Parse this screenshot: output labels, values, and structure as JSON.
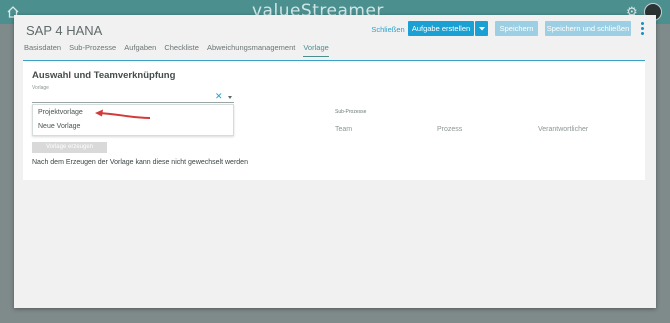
{
  "app": {
    "logo_text": "valueStreamer",
    "icons": [
      "home-icon",
      "settings-icon",
      "avatar"
    ]
  },
  "modal": {
    "title": "SAP 4 HANA",
    "buttons": {
      "close": "Schließen",
      "create_task": "Aufgabe erstellen",
      "save": "Speichern",
      "save_close": "Speichern und schließen"
    },
    "tabs": [
      {
        "label": "Basisdaten",
        "active": false
      },
      {
        "label": "Sub-Prozesse",
        "active": false
      },
      {
        "label": "Aufgaben",
        "active": false
      },
      {
        "label": "Checkliste",
        "active": false
      },
      {
        "label": "Abweichungsmanagement",
        "active": false
      },
      {
        "label": "Vorlage",
        "active": true
      }
    ]
  },
  "section": {
    "title": "Auswahl und Teamverknüpfung",
    "field_label": "Vorlage",
    "options": [
      "Projektvorlage",
      "Neue Vorlage"
    ],
    "create_button": "Vorlage erzeugen",
    "note": "Nach dem Erzeugen der Vorlage kann diese nicht gewechselt werden"
  },
  "subprocesses": {
    "title": "Sub-Prozesse",
    "columns": [
      "Team",
      "Prozess",
      "Verantwortlicher"
    ]
  },
  "colors": {
    "accent": "#1aa0d3",
    "accent_disabled": "#9ccfe3",
    "tab_active": "#4b8f8f",
    "annotation_arrow": "#d33a3a"
  }
}
